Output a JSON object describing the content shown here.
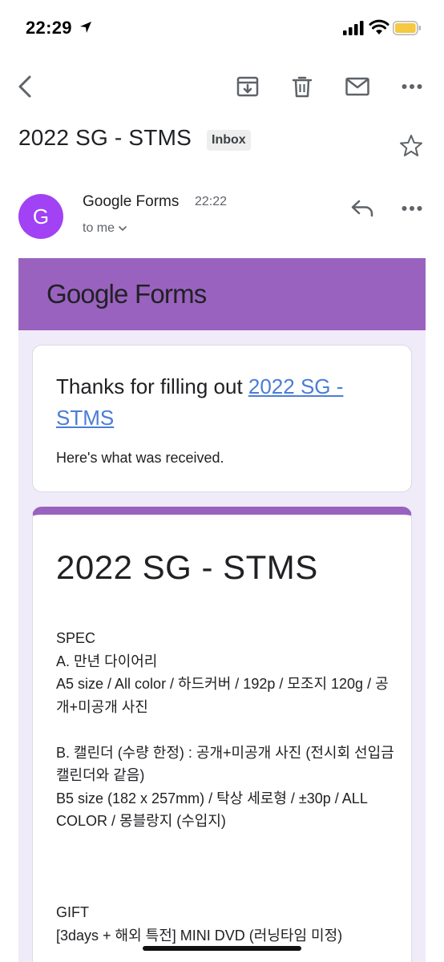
{
  "status_bar": {
    "time": "22:29"
  },
  "subject": {
    "title": "2022 SG - STMS",
    "label": "Inbox"
  },
  "sender": {
    "initial": "G",
    "name": "Google Forms",
    "time": "22:22",
    "recipient": "to me"
  },
  "email": {
    "brand": "Google Forms",
    "thanks_prefix": "Thanks for filling out ",
    "form_link": "2022 SG - STMS",
    "received_text": "Here's what was received.",
    "form_title": "2022 SG - STMS",
    "description_lines": [
      "SPEC",
      "A. 만년 다이어리",
      "A5 size / All color / 하드커버 / 192p / 모조지 120g / 공개+미공개 사진",
      "",
      "B. 캘린더 (수량 한정) : 공개+미공개 사진 (전시회 선입금 캘린더와 같음)",
      "B5 size (182 x 257mm) / 탁상 세로형 / ±30p / ALL COLOR / 몽블랑지 (수입지)",
      "",
      "",
      "",
      "GIFT",
      "[3days + 해외 특전] MINI DVD (러닝타임 미정)"
    ]
  },
  "colors": {
    "brand_purple": "#9a62bf",
    "avatar": "#a142f4",
    "body_bg": "#f0ebf8",
    "link": "#4a7dd6"
  },
  "icons": [
    "back-arrow-icon",
    "archive-icon",
    "trash-icon",
    "mail-icon",
    "more-horizontal-icon",
    "star-icon",
    "reply-icon",
    "chevron-down-icon"
  ]
}
